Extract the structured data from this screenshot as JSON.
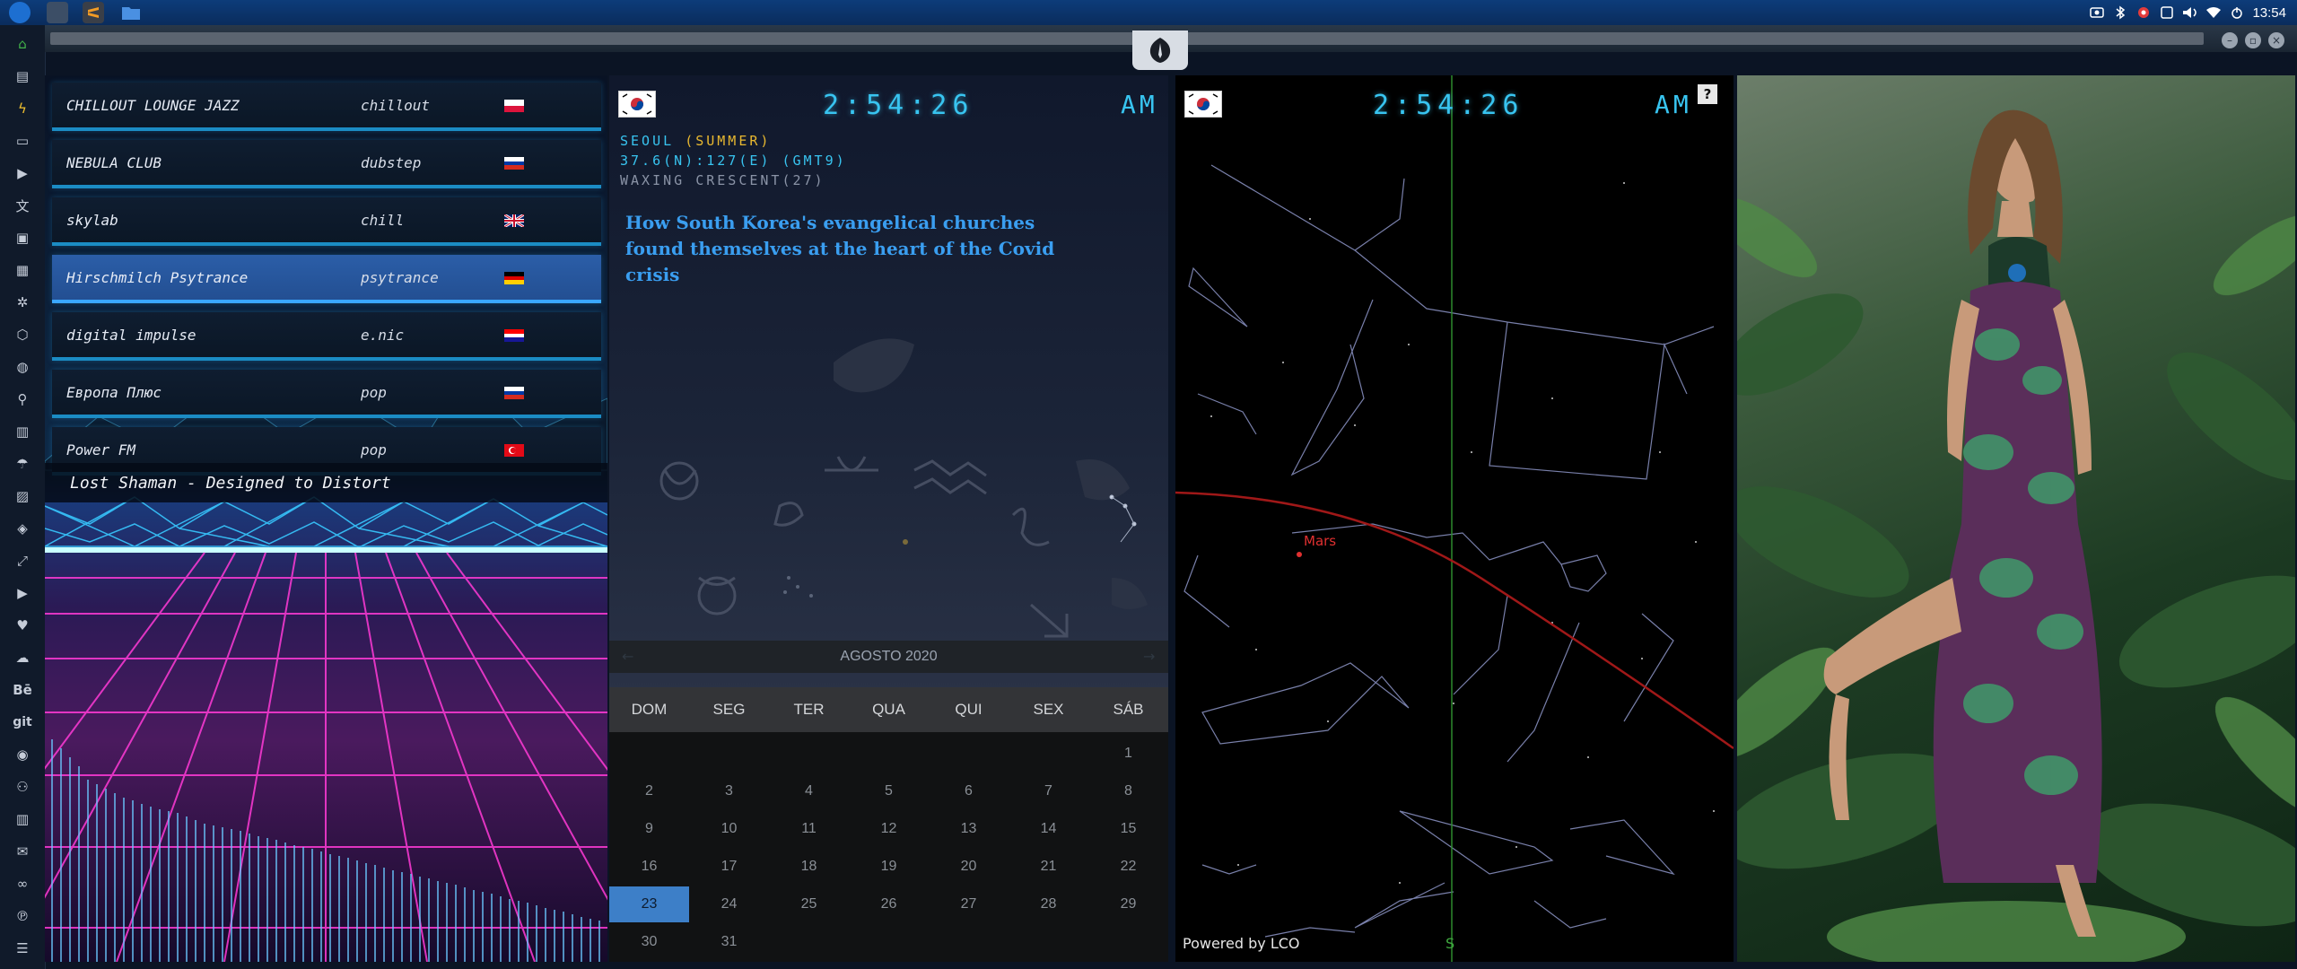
{
  "topbar": {
    "clock": "13:54",
    "tray_icons": [
      "screenshot-icon",
      "bluetooth-icon",
      "settings-gear-icon",
      "notification-icon",
      "volume-icon",
      "wifi-icon",
      "power-icon"
    ]
  },
  "dock": {
    "icons": [
      "home-icon",
      "document-icon",
      "bolt-icon",
      "archive-icon",
      "play-icon",
      "translate-icon",
      "image-icon",
      "card-icon",
      "settings-icon",
      "hexagon-icon",
      "globe-icon",
      "search-icon",
      "map-icon",
      "umbrella-icon",
      "contacts-icon",
      "tag-icon",
      "expand-icon",
      "youtube-icon",
      "heart-icon",
      "cloud-icon",
      "behance-icon",
      "git-icon",
      "github-icon",
      "bicycle-icon",
      "map-fold-icon",
      "mail-icon",
      "link-icon",
      "pinterest-icon",
      "menu-icon"
    ],
    "labels": {
      "behance": "Bē",
      "git": "git"
    }
  },
  "radio": {
    "stations": [
      {
        "name": "CHILLOUT LOUNGE JAZZ",
        "genre": "chillout",
        "flag": "poland"
      },
      {
        "name": "NEBULA CLUB",
        "genre": "dubstep",
        "flag": "russia"
      },
      {
        "name": "skylab",
        "genre": "chill",
        "flag": "uk"
      },
      {
        "name": "Hirschmilch Psytrance",
        "genre": "psytrance",
        "flag": "germany"
      },
      {
        "name": "digital impulse",
        "genre": "e.nic",
        "flag": "croatia"
      },
      {
        "name": "Европа Плюс",
        "genre": "pop",
        "flag": "russia"
      },
      {
        "name": "Power FM",
        "genre": "pop",
        "flag": "turkey"
      }
    ],
    "now_playing": "Lost Shaman - Designed to Distort",
    "accent": "#1b8cc4",
    "active_color": "#2b5ea8"
  },
  "world_clock": {
    "time": "2:54:26",
    "ampm": "AM",
    "city": "SEOUL",
    "season": "(SUMMER)",
    "coords": "37.6(N):127(E) (GMT9)",
    "moon": "WAXING CRESCENT(27)",
    "news": "How South Korea's evangelical churches found themselves at the heart of the Covid crisis"
  },
  "calendar": {
    "month_title": "AGOSTO 2020",
    "prev": "←",
    "next": "→",
    "weekdays": [
      "DOM",
      "SEG",
      "TER",
      "QUA",
      "QUI",
      "SEX",
      "SÁB"
    ],
    "rows": [
      [
        "",
        "",
        "",
        "",
        "",
        "",
        "1"
      ],
      [
        "2",
        "3",
        "4",
        "5",
        "6",
        "7",
        "8"
      ],
      [
        "9",
        "10",
        "11",
        "12",
        "13",
        "14",
        "15"
      ],
      [
        "16",
        "17",
        "18",
        "19",
        "20",
        "21",
        "22"
      ],
      [
        "23",
        "24",
        "25",
        "26",
        "27",
        "28",
        "29"
      ],
      [
        "30",
        "31",
        "",
        "",
        "",
        "",
        ""
      ]
    ],
    "today": "23",
    "today_color": "#3d7fc8"
  },
  "sky": {
    "time": "2:54:26",
    "ampm": "AM",
    "help": "?",
    "planet_label": "Mars",
    "direction": "S",
    "credit": "Powered by LCO"
  }
}
